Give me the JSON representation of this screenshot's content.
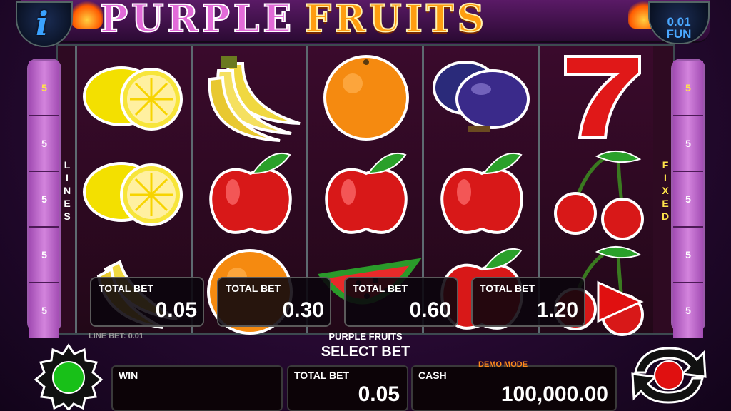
{
  "header": {
    "info_label": "i",
    "title_purple": "PURPLE",
    "title_fruits": "FRUITS",
    "denomination": "0.01",
    "currency": "FUN"
  },
  "side_left": {
    "label": "LINES",
    "values": [
      "5",
      "5",
      "5",
      "5",
      "5"
    ]
  },
  "side_right": {
    "label": "FIXED",
    "values": [
      "5",
      "5",
      "5",
      "5",
      "5"
    ]
  },
  "reels": [
    [
      "lemon",
      "lemon",
      "banana"
    ],
    [
      "banana",
      "apple",
      "orange"
    ],
    [
      "orange",
      "apple",
      "watermelon"
    ],
    [
      "plum",
      "apple",
      "apple"
    ],
    [
      "seven",
      "cherries",
      "cherries"
    ]
  ],
  "bet_options": [
    {
      "label": "TOTAL BET",
      "value": "0.05"
    },
    {
      "label": "TOTAL BET",
      "value": "0.30"
    },
    {
      "label": "TOTAL BET",
      "value": "0.60"
    },
    {
      "label": "TOTAL BET",
      "value": "1.20"
    }
  ],
  "line_bet": "LINE BET: 0.01",
  "game_name": "PURPLE FRUITS",
  "prompt": "SELECT BET",
  "bottom": {
    "win_label": "WIN",
    "win_value": "",
    "total_bet_label": "TOTAL BET",
    "total_bet_value": "0.05",
    "cash_label": "CASH",
    "cash_value": "100,000.00",
    "demo_mode": "DEMO MODE"
  },
  "icons": {
    "info": "info-icon",
    "settings": "gear-icon",
    "play": "play-icon",
    "spin": "spin-arrows-icon"
  },
  "colors": {
    "accent_purple": "#a24cb3",
    "highlight_yellow": "#ffe44a",
    "demo_orange": "#ff8a1a",
    "spin_red": "#e01010",
    "settings_green": "#18c018"
  }
}
